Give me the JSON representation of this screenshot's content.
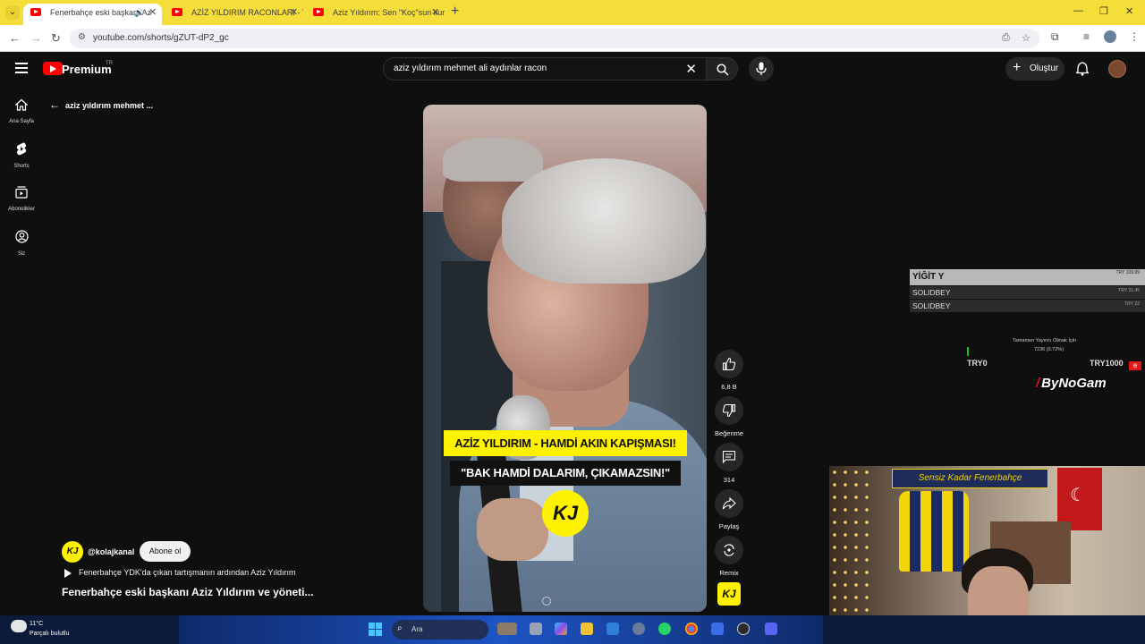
{
  "browser": {
    "tabs": [
      {
        "title": "Fenerbahçe eski başkanı Az"
      },
      {
        "title": "AZİZ YILDIRIM RACONLARI - Yo"
      },
      {
        "title": "Aziz Yıldırım: Sen \"Koç\"sun kur"
      }
    ],
    "url": "youtube.com/shorts/gZUT-dP2_gc"
  },
  "youtube": {
    "logo_text": "Premium",
    "logo_country": "TR",
    "search_query": "aziz yıldırım mehmet ali aydınlar racon",
    "create_label": "Oluştur",
    "guide": [
      {
        "label": "Ana Sayfa",
        "icon": "home-icon"
      },
      {
        "label": "Shorts",
        "icon": "shorts-icon"
      },
      {
        "label": "Abonelikler",
        "icon": "subscriptions-icon"
      },
      {
        "label": "Siz",
        "icon": "you-icon"
      }
    ],
    "back_label": "aziz yıldırım mehmet ..."
  },
  "video": {
    "caption_line1": "AZİZ YILDIRIM - HAMDİ AKIN KAPIŞMASI!",
    "caption_line2": "\"BAK HAMDİ DALARIM, ÇIKAMAZSIN!\"",
    "watermark": "KJ"
  },
  "actions": {
    "likes": "6,8 B",
    "dislike_label": "Beğenme",
    "comments": "314",
    "share_label": "Paylaş",
    "remix_label": "Remix"
  },
  "channel": {
    "avatar_text": "KJ",
    "name": "@kolajkanal",
    "subscribe_label": "Abone ol",
    "description": "Fenerbahçe YDK'da çıkan tartışmanın ardından Aziz Yıldırım",
    "title": "Fenerbahçe eski başkanı Aziz Yıldırım ve yöneti..."
  },
  "overlay": {
    "top_donor": {
      "name": "YİĞİT Y",
      "amount": "TRY 109.99"
    },
    "donors": [
      {
        "name": "SOLIDBEY",
        "amount": "TRY 21.45"
      },
      {
        "name": "SOLIDBEY",
        "amount": "TRY 22"
      }
    ],
    "goal_title": "Tamamen Yayıncı Olmak İçin",
    "goal_value": "7236 (0.72%)",
    "goal_progress": 0.0072,
    "goal_min": "TRY0",
    "goal_max": "TRY1000",
    "brand": "ByNoGam",
    "brand_slash": "/"
  },
  "webcam": {
    "banner": "Sensiz Kadar Fenerbahçe"
  },
  "taskbar": {
    "temperature": "11°C",
    "condition": "Parçalı bulutlu",
    "search_label": "Ara"
  },
  "colors": {
    "tabbar": "#f5dd3a",
    "youtube_red": "#ff0000",
    "caption_yellow": "#fff200",
    "background": "#0f0f0f"
  }
}
